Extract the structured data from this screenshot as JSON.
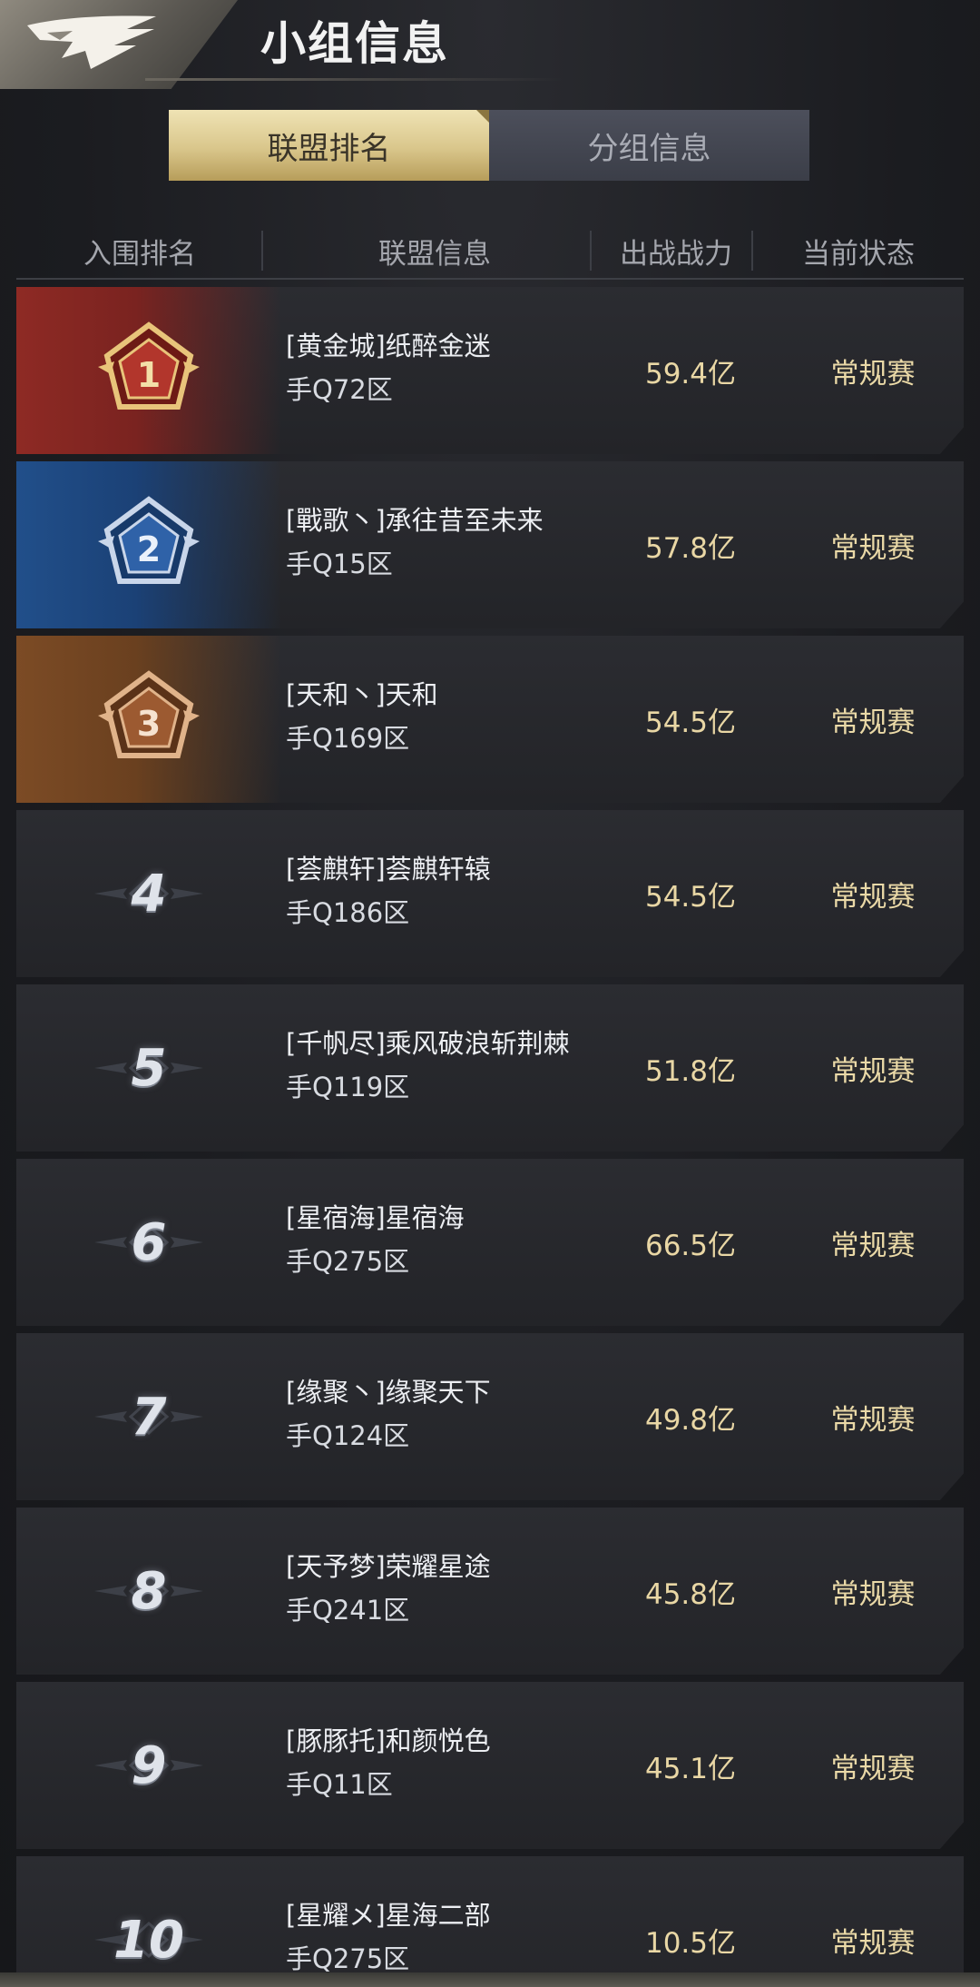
{
  "header": {
    "title": "小组信息"
  },
  "tabs": [
    {
      "label": "联盟排名",
      "active": true
    },
    {
      "label": "分组信息",
      "active": false
    }
  ],
  "table": {
    "columns": [
      "入围排名",
      "联盟信息",
      "出战战力",
      "当前状态"
    ],
    "rows": [
      {
        "rank": "1",
        "name": "[黄金城]纸醉金迷",
        "server": "手Q72区",
        "power": "59.4亿",
        "status": "常规赛",
        "medal": "gold"
      },
      {
        "rank": "2",
        "name": "[戰歌丶]承往昔至未来",
        "server": "手Q15区",
        "power": "57.8亿",
        "status": "常规赛",
        "medal": "blue"
      },
      {
        "rank": "3",
        "name": "[天和丶]天和",
        "server": "手Q169区",
        "power": "54.5亿",
        "status": "常规赛",
        "medal": "bronze"
      },
      {
        "rank": "4",
        "name": "[荟麒轩]荟麒轩辕",
        "server": "手Q186区",
        "power": "54.5亿",
        "status": "常规赛",
        "medal": "none"
      },
      {
        "rank": "5",
        "name": "[千帆尽]乘风破浪斩荆棘",
        "server": "手Q119区",
        "power": "51.8亿",
        "status": "常规赛",
        "medal": "none"
      },
      {
        "rank": "6",
        "name": "[星宿海]星宿海",
        "server": "手Q275区",
        "power": "66.5亿",
        "status": "常规赛",
        "medal": "none"
      },
      {
        "rank": "7",
        "name": "[缘聚丶]缘聚天下",
        "server": "手Q124区",
        "power": "49.8亿",
        "status": "常规赛",
        "medal": "none"
      },
      {
        "rank": "8",
        "name": "[天予梦]荣耀星途",
        "server": "手Q241区",
        "power": "45.8亿",
        "status": "常规赛",
        "medal": "none"
      },
      {
        "rank": "9",
        "name": "[豚豚托]和颜悦色",
        "server": "手Q11区",
        "power": "45.1亿",
        "status": "常规赛",
        "medal": "none"
      },
      {
        "rank": "10",
        "name": "[星耀メ]星海二部",
        "server": "手Q275区",
        "power": "10.5亿",
        "status": "常规赛",
        "medal": "none"
      }
    ]
  },
  "colors": {
    "gold_medal": "#8e2a24",
    "blue_medal": "#214f8a",
    "bronze_medal": "#7c4b25",
    "power_text": "#e9d7a5",
    "tab_active": "#d9c68b"
  }
}
